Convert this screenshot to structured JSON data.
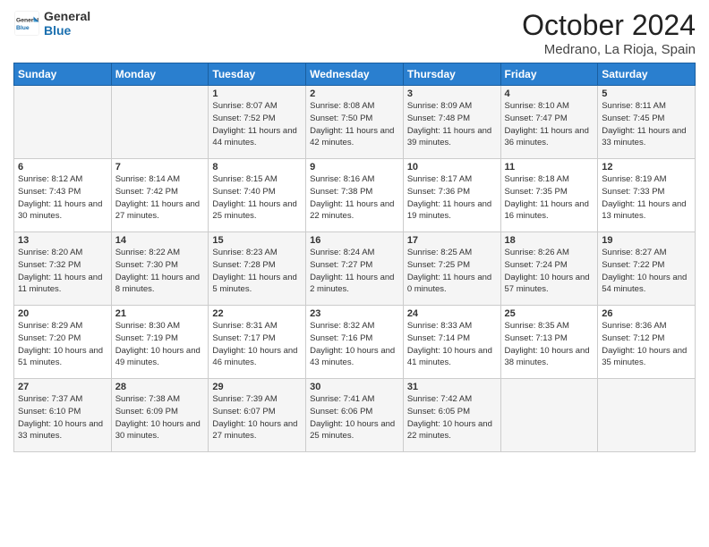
{
  "header": {
    "logo_line1": "General",
    "logo_line2": "Blue",
    "month": "October 2024",
    "location": "Medrano, La Rioja, Spain"
  },
  "days_of_week": [
    "Sunday",
    "Monday",
    "Tuesday",
    "Wednesday",
    "Thursday",
    "Friday",
    "Saturday"
  ],
  "weeks": [
    [
      {
        "day": "",
        "info": ""
      },
      {
        "day": "",
        "info": ""
      },
      {
        "day": "1",
        "sunrise": "Sunrise: 8:07 AM",
        "sunset": "Sunset: 7:52 PM",
        "daylight": "Daylight: 11 hours and 44 minutes."
      },
      {
        "day": "2",
        "sunrise": "Sunrise: 8:08 AM",
        "sunset": "Sunset: 7:50 PM",
        "daylight": "Daylight: 11 hours and 42 minutes."
      },
      {
        "day": "3",
        "sunrise": "Sunrise: 8:09 AM",
        "sunset": "Sunset: 7:48 PM",
        "daylight": "Daylight: 11 hours and 39 minutes."
      },
      {
        "day": "4",
        "sunrise": "Sunrise: 8:10 AM",
        "sunset": "Sunset: 7:47 PM",
        "daylight": "Daylight: 11 hours and 36 minutes."
      },
      {
        "day": "5",
        "sunrise": "Sunrise: 8:11 AM",
        "sunset": "Sunset: 7:45 PM",
        "daylight": "Daylight: 11 hours and 33 minutes."
      }
    ],
    [
      {
        "day": "6",
        "sunrise": "Sunrise: 8:12 AM",
        "sunset": "Sunset: 7:43 PM",
        "daylight": "Daylight: 11 hours and 30 minutes."
      },
      {
        "day": "7",
        "sunrise": "Sunrise: 8:14 AM",
        "sunset": "Sunset: 7:42 PM",
        "daylight": "Daylight: 11 hours and 27 minutes."
      },
      {
        "day": "8",
        "sunrise": "Sunrise: 8:15 AM",
        "sunset": "Sunset: 7:40 PM",
        "daylight": "Daylight: 11 hours and 25 minutes."
      },
      {
        "day": "9",
        "sunrise": "Sunrise: 8:16 AM",
        "sunset": "Sunset: 7:38 PM",
        "daylight": "Daylight: 11 hours and 22 minutes."
      },
      {
        "day": "10",
        "sunrise": "Sunrise: 8:17 AM",
        "sunset": "Sunset: 7:36 PM",
        "daylight": "Daylight: 11 hours and 19 minutes."
      },
      {
        "day": "11",
        "sunrise": "Sunrise: 8:18 AM",
        "sunset": "Sunset: 7:35 PM",
        "daylight": "Daylight: 11 hours and 16 minutes."
      },
      {
        "day": "12",
        "sunrise": "Sunrise: 8:19 AM",
        "sunset": "Sunset: 7:33 PM",
        "daylight": "Daylight: 11 hours and 13 minutes."
      }
    ],
    [
      {
        "day": "13",
        "sunrise": "Sunrise: 8:20 AM",
        "sunset": "Sunset: 7:32 PM",
        "daylight": "Daylight: 11 hours and 11 minutes."
      },
      {
        "day": "14",
        "sunrise": "Sunrise: 8:22 AM",
        "sunset": "Sunset: 7:30 PM",
        "daylight": "Daylight: 11 hours and 8 minutes."
      },
      {
        "day": "15",
        "sunrise": "Sunrise: 8:23 AM",
        "sunset": "Sunset: 7:28 PM",
        "daylight": "Daylight: 11 hours and 5 minutes."
      },
      {
        "day": "16",
        "sunrise": "Sunrise: 8:24 AM",
        "sunset": "Sunset: 7:27 PM",
        "daylight": "Daylight: 11 hours and 2 minutes."
      },
      {
        "day": "17",
        "sunrise": "Sunrise: 8:25 AM",
        "sunset": "Sunset: 7:25 PM",
        "daylight": "Daylight: 11 hours and 0 minutes."
      },
      {
        "day": "18",
        "sunrise": "Sunrise: 8:26 AM",
        "sunset": "Sunset: 7:24 PM",
        "daylight": "Daylight: 10 hours and 57 minutes."
      },
      {
        "day": "19",
        "sunrise": "Sunrise: 8:27 AM",
        "sunset": "Sunset: 7:22 PM",
        "daylight": "Daylight: 10 hours and 54 minutes."
      }
    ],
    [
      {
        "day": "20",
        "sunrise": "Sunrise: 8:29 AM",
        "sunset": "Sunset: 7:20 PM",
        "daylight": "Daylight: 10 hours and 51 minutes."
      },
      {
        "day": "21",
        "sunrise": "Sunrise: 8:30 AM",
        "sunset": "Sunset: 7:19 PM",
        "daylight": "Daylight: 10 hours and 49 minutes."
      },
      {
        "day": "22",
        "sunrise": "Sunrise: 8:31 AM",
        "sunset": "Sunset: 7:17 PM",
        "daylight": "Daylight: 10 hours and 46 minutes."
      },
      {
        "day": "23",
        "sunrise": "Sunrise: 8:32 AM",
        "sunset": "Sunset: 7:16 PM",
        "daylight": "Daylight: 10 hours and 43 minutes."
      },
      {
        "day": "24",
        "sunrise": "Sunrise: 8:33 AM",
        "sunset": "Sunset: 7:14 PM",
        "daylight": "Daylight: 10 hours and 41 minutes."
      },
      {
        "day": "25",
        "sunrise": "Sunrise: 8:35 AM",
        "sunset": "Sunset: 7:13 PM",
        "daylight": "Daylight: 10 hours and 38 minutes."
      },
      {
        "day": "26",
        "sunrise": "Sunrise: 8:36 AM",
        "sunset": "Sunset: 7:12 PM",
        "daylight": "Daylight: 10 hours and 35 minutes."
      }
    ],
    [
      {
        "day": "27",
        "sunrise": "Sunrise: 7:37 AM",
        "sunset": "Sunset: 6:10 PM",
        "daylight": "Daylight: 10 hours and 33 minutes."
      },
      {
        "day": "28",
        "sunrise": "Sunrise: 7:38 AM",
        "sunset": "Sunset: 6:09 PM",
        "daylight": "Daylight: 10 hours and 30 minutes."
      },
      {
        "day": "29",
        "sunrise": "Sunrise: 7:39 AM",
        "sunset": "Sunset: 6:07 PM",
        "daylight": "Daylight: 10 hours and 27 minutes."
      },
      {
        "day": "30",
        "sunrise": "Sunrise: 7:41 AM",
        "sunset": "Sunset: 6:06 PM",
        "daylight": "Daylight: 10 hours and 25 minutes."
      },
      {
        "day": "31",
        "sunrise": "Sunrise: 7:42 AM",
        "sunset": "Sunset: 6:05 PM",
        "daylight": "Daylight: 10 hours and 22 minutes."
      },
      {
        "day": "",
        "info": ""
      },
      {
        "day": "",
        "info": ""
      }
    ]
  ]
}
